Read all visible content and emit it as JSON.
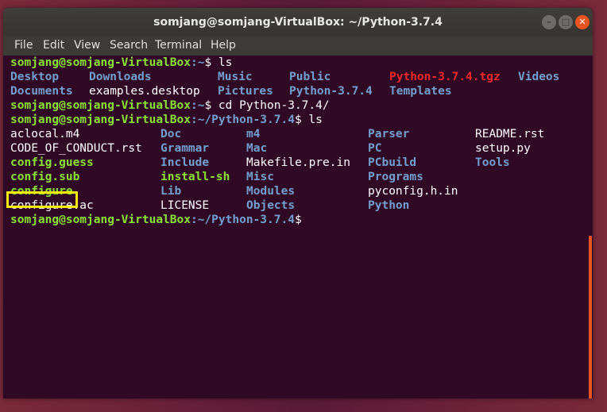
{
  "window": {
    "title": "somjang@somjang-VirtualBox: ~/Python-3.7.4",
    "minimize_glyph": "–",
    "maximize_glyph": "□",
    "close_glyph": "✕"
  },
  "menu": [
    "File",
    "Edit",
    "View",
    "Search",
    "Terminal",
    "Help"
  ],
  "prompt": {
    "user_host": "somjang@somjang-VirtualBox",
    "home": ":~",
    "python_dir": ":~/Python-3.7.4",
    "dollar": "$"
  },
  "commands": {
    "ls1": " ls",
    "cd": " cd Python-3.7.4/",
    "ls2": " ls"
  },
  "home_listing": [
    [
      "Desktop",
      "Downloads",
      "Music",
      "Public",
      "Python-3.7.4.tgz",
      "Videos"
    ],
    [
      "Documents",
      "examples.desktop",
      "Pictures",
      "Python-3.7.4",
      "Templates"
    ]
  ],
  "python_listing": [
    [
      "aclocal.m4",
      "Doc",
      "m4",
      "Parser",
      "README.rst"
    ],
    [
      "CODE_OF_CONDUCT.rst",
      "Grammar",
      "Mac",
      "PC",
      "setup.py"
    ],
    [
      "config.guess",
      "Include",
      "Makefile.pre.in",
      "PCbuild",
      "Tools"
    ],
    [
      "config.sub",
      "install-sh",
      "Misc",
      "Programs"
    ],
    [
      "configure",
      "Lib",
      "Modules",
      "pyconfig.h.in"
    ],
    [
      "configure.ac",
      "LICENSE",
      "Objects",
      "Python"
    ]
  ],
  "colors": {
    "terminal_bg": "#300a24",
    "prompt_green": "#8ae234",
    "directory_blue": "#729fcf",
    "archive_red": "#ef2929",
    "highlight_yellow": "#f5e90a"
  }
}
